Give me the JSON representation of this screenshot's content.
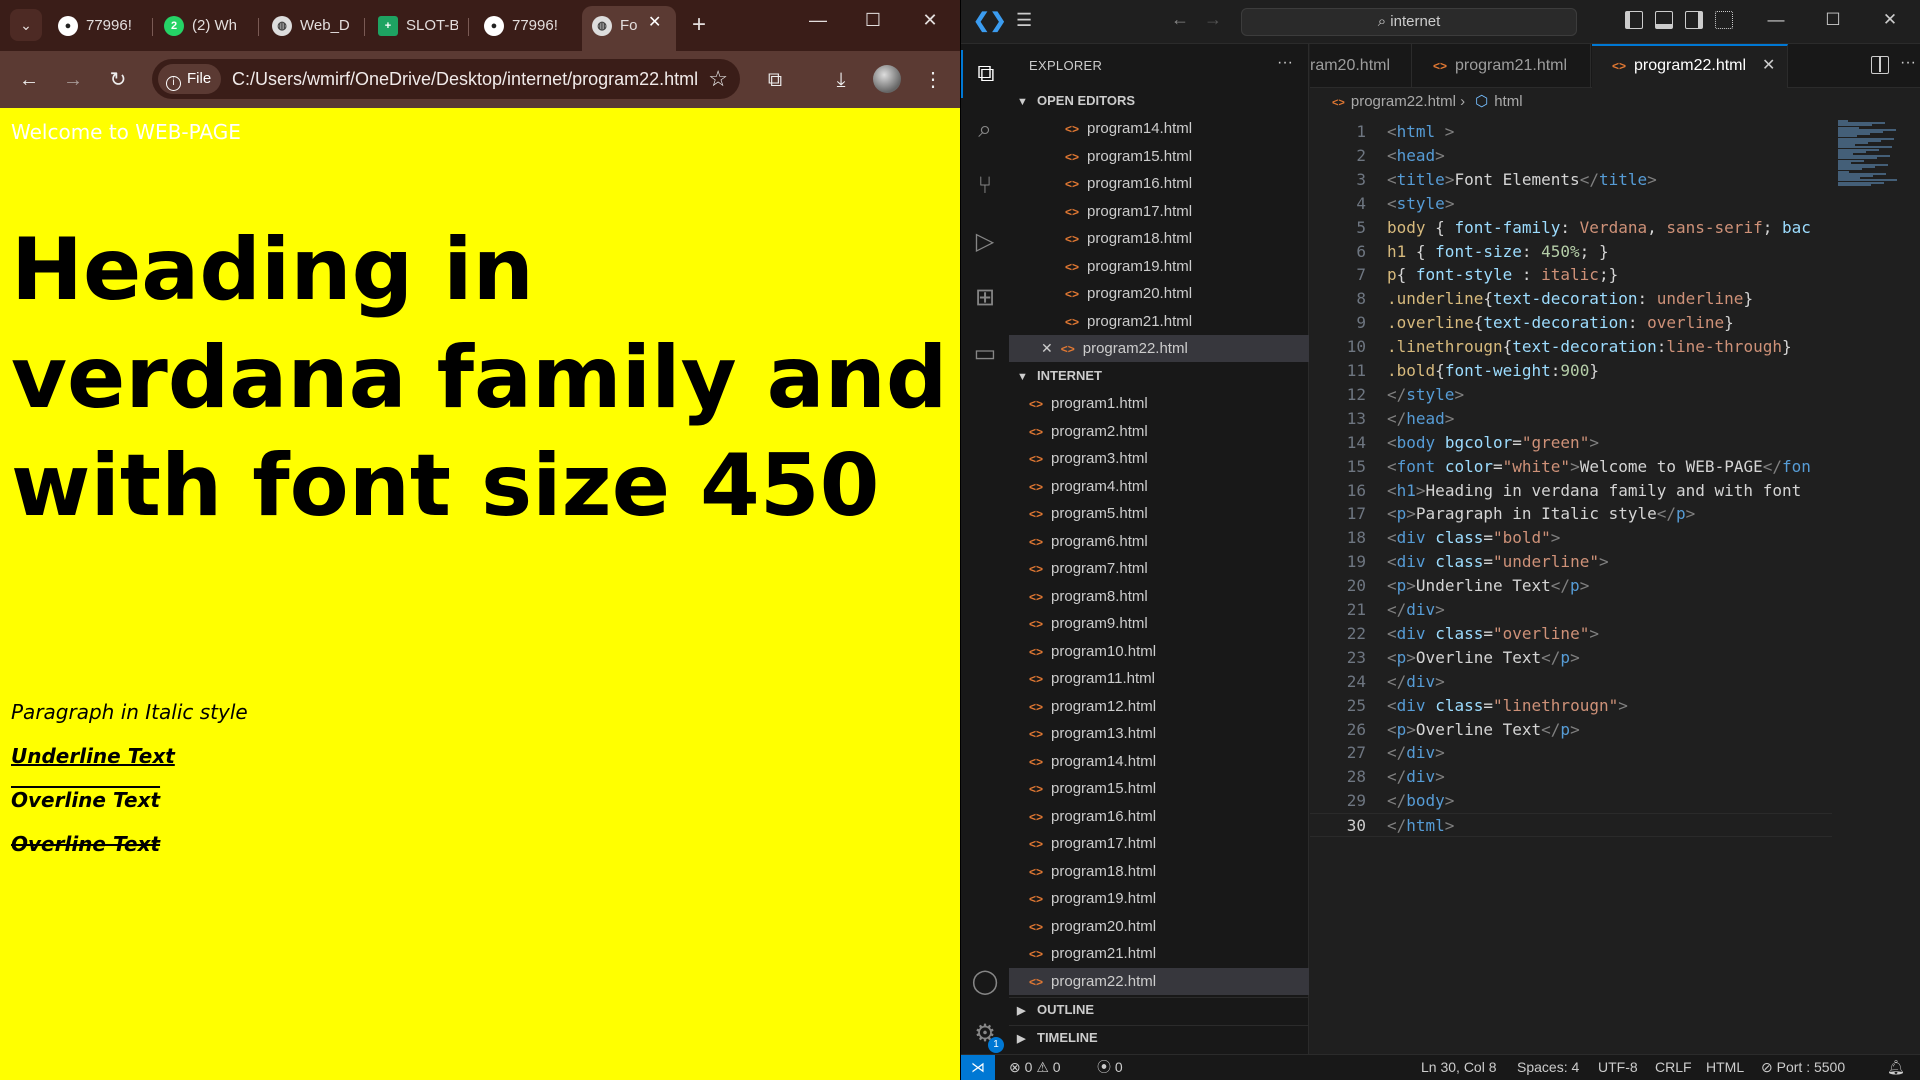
{
  "browser": {
    "tabs": [
      {
        "label": "77996!",
        "icon": "github-icon"
      },
      {
        "label": "(2) Wh",
        "icon": "whatsapp-icon",
        "badge": "2"
      },
      {
        "label": "Web_D",
        "icon": "globe-icon"
      },
      {
        "label": "SLOT-B",
        "icon": "sheets-icon"
      },
      {
        "label": "77996!",
        "icon": "github-icon"
      },
      {
        "label": "Fo",
        "icon": "globe-icon"
      }
    ],
    "chip_label": "File",
    "url": "C:/Users/wmirf/OneDrive/Desktop/internet/program22.html",
    "page": {
      "welcome": "Welcome to WEB-PAGE",
      "heading": "Heading in verdana family and with font size 450",
      "para_italic": "Paragraph in Italic style",
      "para_underline": "Underline Text",
      "para_overline": "Overline Text",
      "para_linethrough": "Overline Text",
      "bgcolor": "#ffff00",
      "font_color": "#ffffff"
    }
  },
  "vscode": {
    "search_text": "internet",
    "explorer_title": "EXPLORER",
    "open_editors_title": "OPEN EDITORS",
    "open_editors": [
      "program14.html",
      "program15.html",
      "program16.html",
      "program17.html",
      "program18.html",
      "program19.html",
      "program20.html",
      "program21.html",
      "program22.html"
    ],
    "folder_title": "INTERNET",
    "folder_files": [
      "program1.html",
      "program2.html",
      "program3.html",
      "program4.html",
      "program5.html",
      "program6.html",
      "program7.html",
      "program8.html",
      "program9.html",
      "program10.html",
      "program11.html",
      "program12.html",
      "program13.html",
      "program14.html",
      "program15.html",
      "program16.html",
      "program17.html",
      "program18.html",
      "program19.html",
      "program20.html",
      "program21.html",
      "program22.html"
    ],
    "outline_title": "OUTLINE",
    "timeline_title": "TIMELINE",
    "editor_tabs": [
      "ram20.html",
      "program21.html",
      "program22.html"
    ],
    "breadcrumb": {
      "file": "program22.html",
      "symbol": "html"
    },
    "code_lines": [
      "1",
      "2",
      "3",
      "4",
      "5",
      "6",
      "7",
      "8",
      "9",
      "10",
      "11",
      "12",
      "13",
      "14",
      "15",
      "16",
      "17",
      "18",
      "19",
      "20",
      "21",
      "22",
      "23",
      "24",
      "25",
      "26",
      "27",
      "28",
      "29",
      "30"
    ],
    "status": {
      "errors": "0",
      "warnings": "0",
      "ports": "0",
      "position": "Ln 30, Col 8",
      "spaces": "Spaces: 4",
      "encoding": "UTF-8",
      "eol": "CRLF",
      "language": "HTML",
      "port": "Port : 5500"
    },
    "settings_badge": "1",
    "accent": "#0078d4"
  }
}
